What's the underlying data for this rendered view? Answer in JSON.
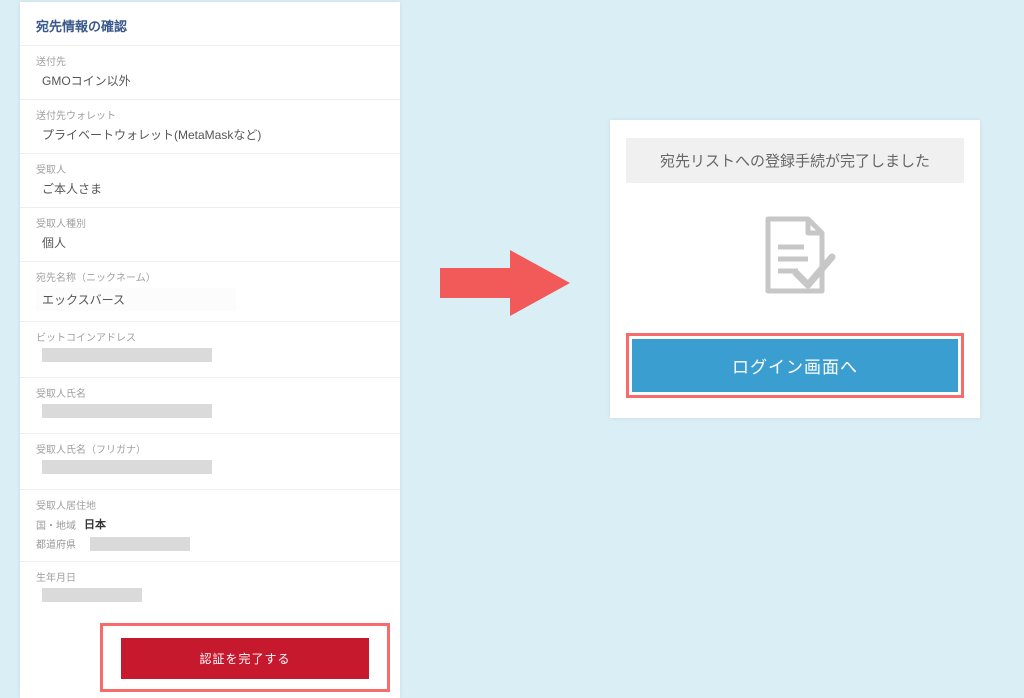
{
  "left": {
    "title": "宛先情報の確認",
    "fields": {
      "destination_label": "送付先",
      "destination_value": "GMOコイン以外",
      "wallet_label": "送付先ウォレット",
      "wallet_value": "プライベートウォレット(MetaMaskなど)",
      "recipient_label": "受取人",
      "recipient_value": "ご本人さま",
      "recipient_type_label": "受取人種別",
      "recipient_type_value": "個人",
      "nickname_label": "宛先名称（ニックネーム）",
      "nickname_value": "エックスバース",
      "btc_address_label": "ビットコインアドレス",
      "recipient_name_label": "受取人氏名",
      "recipient_name_kana_label": "受取人氏名（フリガナ）",
      "residence_label": "受取人居住地",
      "country_label": "国・地域",
      "country_value": "日本",
      "prefecture_label": "都道府県",
      "dob_label": "生年月日"
    },
    "button": "認証を完了する"
  },
  "right": {
    "message": "宛先リストへの登録手続が完了しました",
    "button": "ログイン画面へ"
  }
}
